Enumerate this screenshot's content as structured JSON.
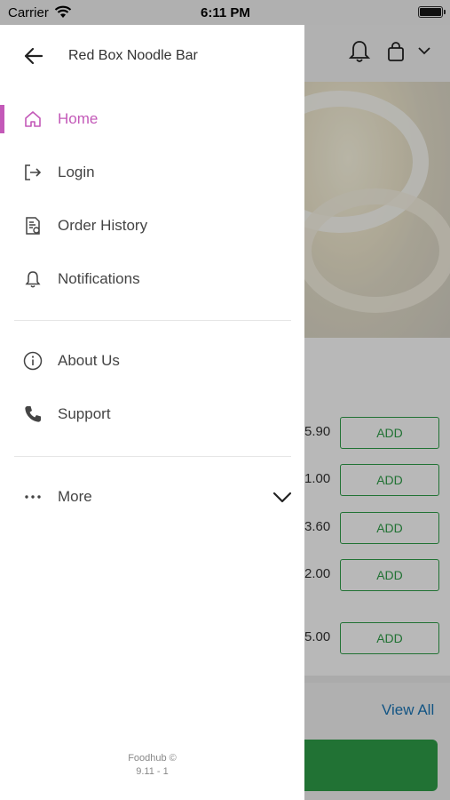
{
  "status_bar": {
    "carrier": "Carrier",
    "time": "6:11 PM"
  },
  "drawer": {
    "title": "Red Box Noodle Bar",
    "items_primary": [
      {
        "label": "Home",
        "icon": "home-icon",
        "active": true
      },
      {
        "label": "Login",
        "icon": "login-icon"
      },
      {
        "label": "Order History",
        "icon": "receipt-icon"
      },
      {
        "label": "Notifications",
        "icon": "bell-icon"
      }
    ],
    "items_secondary": [
      {
        "label": "About Us",
        "icon": "info-icon"
      },
      {
        "label": "Support",
        "icon": "phone-icon"
      }
    ],
    "more": {
      "label": "More"
    },
    "footer": {
      "line1": "Foodhub ©",
      "line2": "9.11 - 1"
    },
    "accent_color": "#c359b8"
  },
  "background": {
    "prices": [
      ".90",
      ".00",
      ".60",
      ".00",
      ".00"
    ],
    "prices_prefix": [
      "5",
      "1",
      "3",
      "2",
      "5"
    ],
    "add_label": "ADD",
    "view_all": "View All",
    "accent_color": "#2e9e48"
  }
}
